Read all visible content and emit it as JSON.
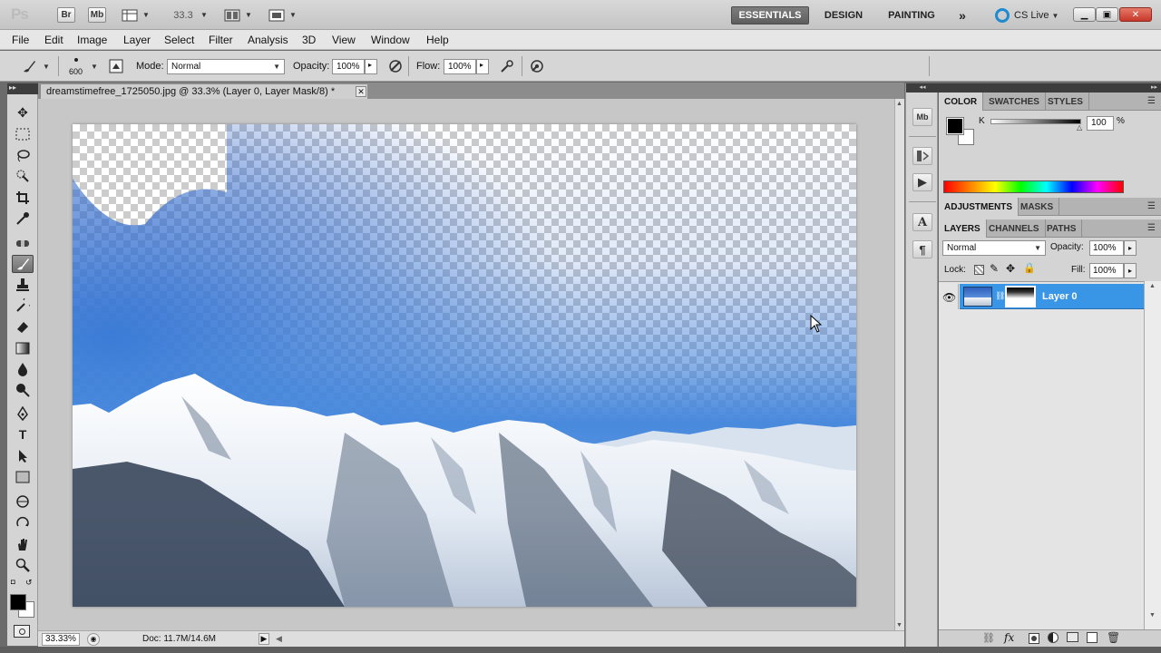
{
  "appbar": {
    "logo": "Ps",
    "bridge": "Br",
    "minibridge": "Mb",
    "zoom": "33.3",
    "workspaces": [
      "ESSENTIALS",
      "DESIGN",
      "PAINTING"
    ],
    "cslive": "CS Live"
  },
  "menus": [
    "File",
    "Edit",
    "Image",
    "Layer",
    "Select",
    "Filter",
    "Analysis",
    "3D",
    "View",
    "Window",
    "Help"
  ],
  "options": {
    "brush_size": "600",
    "mode_label": "Mode:",
    "mode_value": "Normal",
    "opacity_label": "Opacity:",
    "opacity_value": "100%",
    "flow_label": "Flow:",
    "flow_value": "100%"
  },
  "document": {
    "tab_title": "dreamstimefree_1725050.jpg @ 33.3% (Layer 0, Layer Mask/8) *",
    "status_zoom": "33.33%",
    "status_doc": "Doc: 11.7M/14.6M"
  },
  "color_panel": {
    "tabs": [
      "COLOR",
      "SWATCHES",
      "STYLES"
    ],
    "channel": "K",
    "value": "100",
    "unit": "%"
  },
  "adjust_panel": {
    "tabs": [
      "ADJUSTMENTS",
      "MASKS"
    ]
  },
  "layers_panel": {
    "tabs": [
      "LAYERS",
      "CHANNELS",
      "PATHS"
    ],
    "blend_mode": "Normal",
    "opacity_label": "Opacity:",
    "opacity_value": "100%",
    "lock_label": "Lock:",
    "fill_label": "Fill:",
    "fill_value": "100%",
    "layer_name": "Layer 0"
  },
  "colors": {
    "accent": "#3995e6",
    "sky": "#3a78d4",
    "snow": "#ffffff"
  }
}
